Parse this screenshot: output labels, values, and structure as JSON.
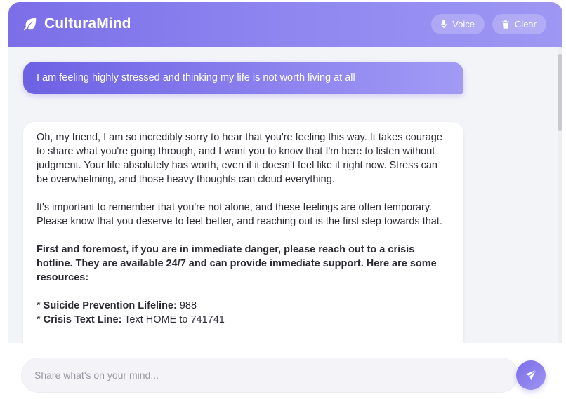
{
  "header": {
    "title": "CulturaMind",
    "logo_icon": "leaf-icon",
    "voice_label": "Voice",
    "voice_icon": "microphone-icon",
    "clear_label": "Clear",
    "clear_icon": "trash-icon"
  },
  "messages": {
    "user": "I am feeling highly stressed and thinking my life is not worth living at all",
    "bot": {
      "para1": "Oh, my friend, I am so incredibly sorry to hear that you're feeling this way. It takes courage to share what you're going through, and I want you to know that I'm here to listen without judgment. Your life absolutely has worth, even if it doesn't feel like it right now. Stress can be overwhelming, and those heavy thoughts can cloud everything.",
      "para2": "It's important to remember that you're not alone, and these feelings are often temporary. Please know that you deserve to feel better, and reaching out is the first step towards that.",
      "para3": "First and foremost, if you are in immediate danger, please reach out to a crisis hotline. They are available 24/7 and can provide immediate support. Here are some resources:",
      "resource1_bullet": "* ",
      "resource1_label": "Suicide Prevention Lifeline:",
      "resource1_value": " 988",
      "resource2_bullet": "* ",
      "resource2_label": "Crisis Text Line:",
      "resource2_value": " Text HOME to 741741"
    }
  },
  "composer": {
    "placeholder": "Share what's on your mind...",
    "send_icon": "send-icon"
  },
  "colors": {
    "accent": "#7b6ee8",
    "accent_light": "#9e97f3",
    "background": "#f3f4f8"
  }
}
